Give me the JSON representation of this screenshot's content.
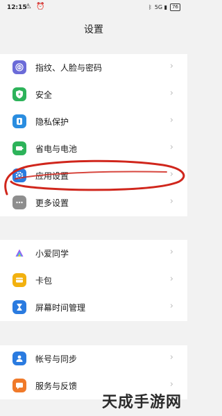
{
  "status_bar": {
    "time": "12:15",
    "notifications": "⚠ ⏰",
    "bluetooth": "ᛒ",
    "signal": "5G ▮",
    "battery": "76"
  },
  "page_title": "设置",
  "groups": [
    {
      "items": [
        {
          "label": "指纹、人脸与密码",
          "icon": "fingerprint-icon",
          "color": "#6b6bd8"
        },
        {
          "label": "安全",
          "icon": "shield-bolt-icon",
          "color": "#2db35a"
        },
        {
          "label": "隐私保护",
          "icon": "privacy-icon",
          "color": "#2a8de0"
        },
        {
          "label": "省电与电池",
          "icon": "battery-icon",
          "color": "#2db35a"
        },
        {
          "label": "应用设置",
          "icon": "gear-icon",
          "color": "#2a7be0"
        },
        {
          "label": "更多设置",
          "icon": "more-icon",
          "color": "#8e8e8e"
        }
      ]
    },
    {
      "items": [
        {
          "label": "小爱同学",
          "icon": "xiaoai-icon",
          "color": "#ffffff"
        },
        {
          "label": "卡包",
          "icon": "wallet-icon",
          "color": "#f2b10f"
        },
        {
          "label": "屏幕时间管理",
          "icon": "hourglass-icon",
          "color": "#2a7be0"
        }
      ]
    },
    {
      "items": [
        {
          "label": "帐号与同步",
          "icon": "account-icon",
          "color": "#2a7be0"
        },
        {
          "label": "服务与反馈",
          "icon": "feedback-icon",
          "color": "#f07a2a"
        }
      ]
    }
  ],
  "chevron": "›",
  "watermark": "天成手游网",
  "annotation_color": "#d0261c"
}
